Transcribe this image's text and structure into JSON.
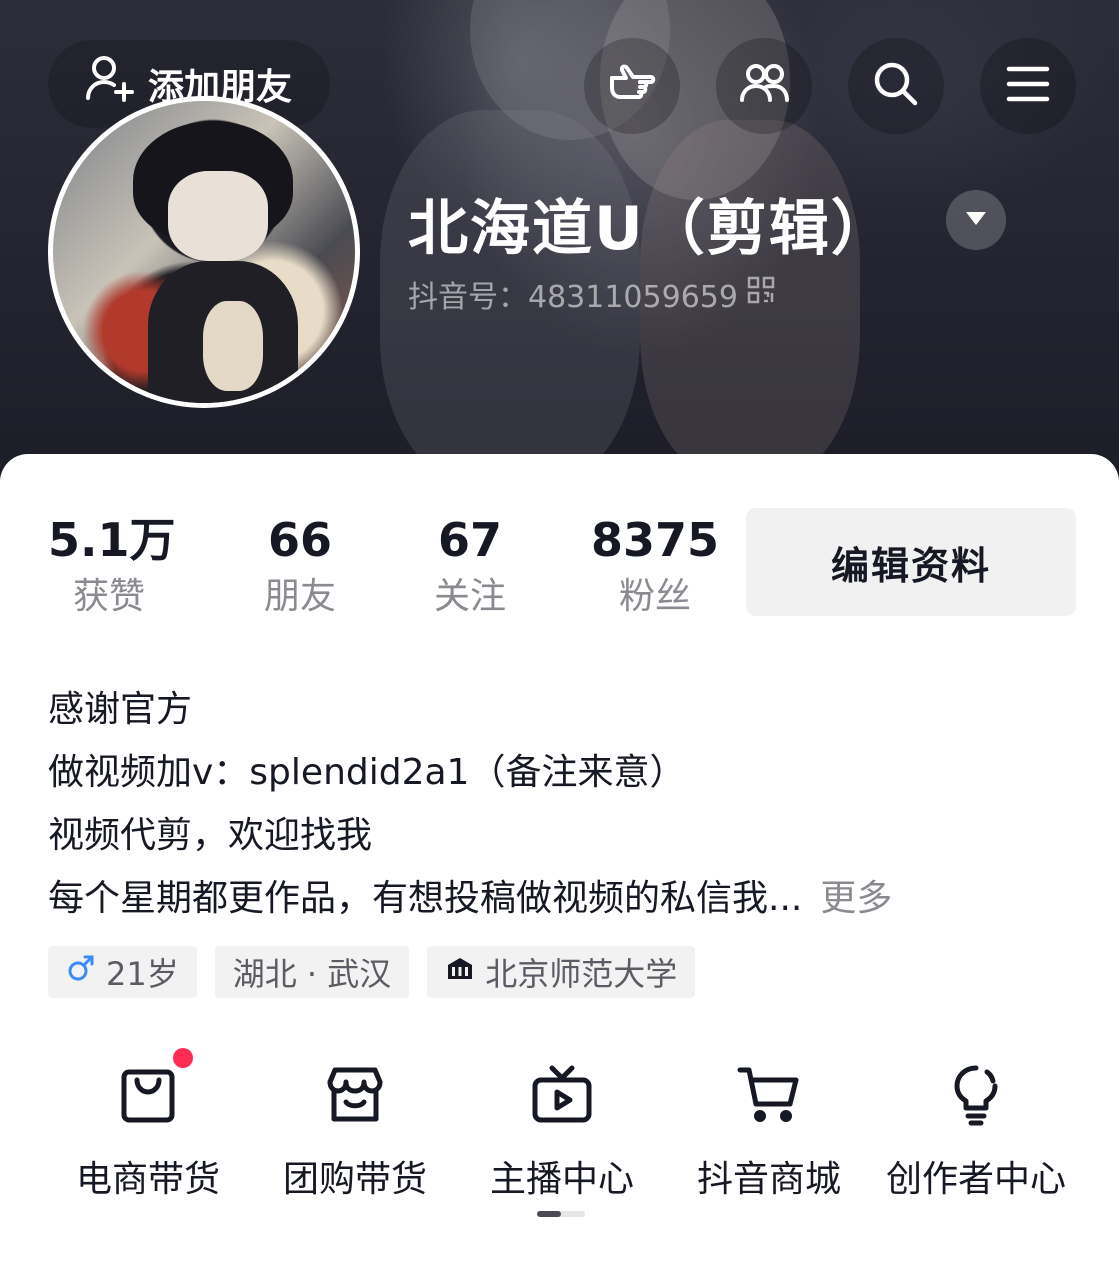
{
  "header": {
    "add_friend_label": "添加朋友",
    "nickname": "北海道U（剪辑）",
    "douyin_id": "抖音号：48311059659"
  },
  "stats": [
    {
      "value": "5.1万",
      "label": "获赞"
    },
    {
      "value": "66",
      "label": "朋友"
    },
    {
      "value": "67",
      "label": "关注"
    },
    {
      "value": "8375",
      "label": "粉丝"
    }
  ],
  "edit_profile_label": "编辑资料",
  "bio": {
    "lines": [
      "感谢官方",
      "做视频加v：splendid2a1（备注来意）",
      "视频代剪，欢迎找我",
      "每个星期都更作品，有想投稿做视频的私信我..."
    ],
    "more_label": "更多"
  },
  "tags": {
    "age": "21岁",
    "location": "湖北 · 武汉",
    "school": "北京师范大学"
  },
  "shortcuts": [
    {
      "label": "电商带货",
      "icon": "shopping-bag-icon",
      "badge": true
    },
    {
      "label": "团购带货",
      "icon": "storefront-icon",
      "badge": false
    },
    {
      "label": "主播中心",
      "icon": "tv-play-icon",
      "badge": false
    },
    {
      "label": "抖音商城",
      "icon": "cart-icon",
      "badge": false
    },
    {
      "label": "创作者中心",
      "icon": "lightbulb-icon",
      "badge": false
    }
  ],
  "colors": {
    "accent_red": "#fe2c55",
    "male_blue": "#3d8af7",
    "banner_dark": "#252632"
  }
}
